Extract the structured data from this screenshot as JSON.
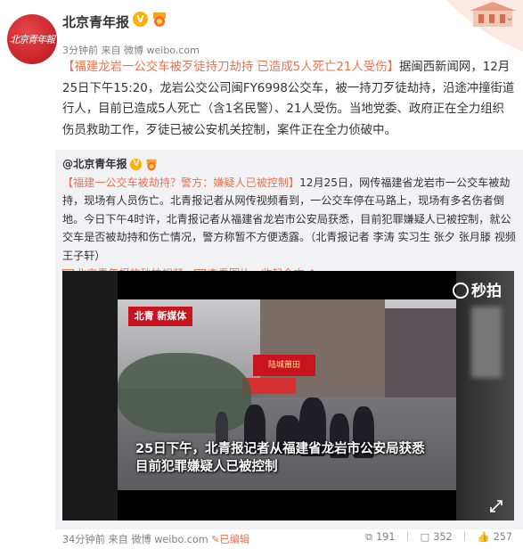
{
  "post": {
    "author": "北京青年报",
    "avatar_text": "北京青年報",
    "time": "3分钟前",
    "source_prefix": "来自",
    "source": "微博 weibo.com",
    "hashtag_title": "【福建龙岩一公交车被歹徒持刀劫持 已造成5人死亡21人受伤】",
    "body": "据闽西新闻网，12月25日下午15:20，龙岩公交公司闽FY6998公交车，被一持刀歹徒劫持，沿途冲撞街道行人，目前已造成5人死亡（含1名民警）、21人受伤。当地党委、政府正在全力组织伤员救助工作，歹徒已被公安机关控制，案件正在全力侦破中。"
  },
  "repost": {
    "author": "@北京青年报",
    "title": "【福建一公交车被劫持？警方：嫌疑人已被控制】",
    "body": "12月25日，网传福建省龙岩市一公交车被劫持，现场有人员伤亡。北青报记者从网传视频看到，一公交车停在马路上，现场有多名伤者倒地。今日下午4时许，北青报记者从福建省龙岩市公安局获悉，目前犯罪嫌疑人已被控制，就公交车是否被劫持和伤亡情况，警方称暂不方便透露。（北青报记者 李涛 实习生 张夕 张月滕 视频 王子轩）",
    "link_video": "北京青年报的秒拍视频",
    "link_images": "查看图片",
    "link_collapse": "收起全文"
  },
  "video": {
    "watermark": "秒拍",
    "news_logo": "北青 新媒体",
    "shop_sign": "陆城莆田",
    "caption_line1": "25日下午，北青报记者从福建省龙岩市公安局获悉",
    "caption_line2": "目前犯罪嫌疑人已被控制"
  },
  "footer": {
    "time": "34分钟前",
    "source_prefix": "来自",
    "source": "微博 weibo.com",
    "edited": "已编辑",
    "shares": "191",
    "comments": "352",
    "likes": "257"
  },
  "colors": {
    "accent": "#eb7350",
    "vip_badge": "#ffb000",
    "avatar_red": "#c8141e"
  },
  "icons": [
    "chevron-down-icon",
    "verified-icon",
    "medal-icon",
    "video-link-icon",
    "image-link-icon",
    "collapse-icon",
    "share-icon",
    "comment-icon",
    "like-icon",
    "fullscreen-icon",
    "miaopai-logo-icon"
  ]
}
